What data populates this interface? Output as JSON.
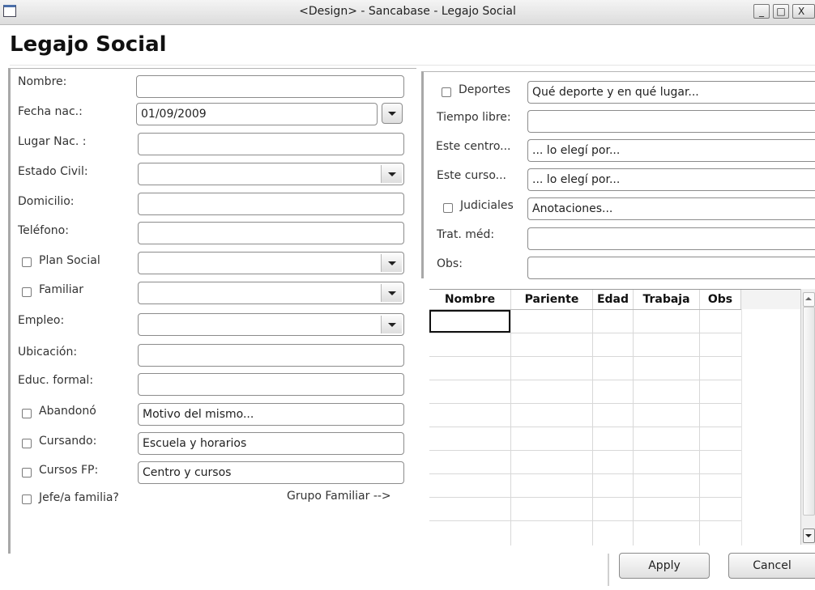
{
  "window": {
    "title": "<Design> - Sancabase - Legajo Social",
    "minimize_label": "_",
    "maximize_label": "□",
    "close_label": "X"
  },
  "heading": "Legajo Social",
  "left": {
    "nombre_label": "Nombre:",
    "nombre_value": "",
    "fecha_label": "Fecha nac.:",
    "fecha_value": "01/09/2009",
    "lugar_label": "Lugar Nac. :",
    "lugar_value": "",
    "estado_label": "Estado Civil:",
    "estado_value": "",
    "domicilio_label": "Domicilio:",
    "domicilio_value": "",
    "telefono_label": "Teléfono:",
    "telefono_value": "",
    "plan_label": "Plan Social",
    "plan_value": "",
    "familiar_label": "Familiar",
    "familiar_value": "",
    "empleo_label": "Empleo:",
    "empleo_value": "",
    "ubicacion_label": "Ubicación:",
    "ubicacion_value": "",
    "educ_label": "Educ. formal:",
    "educ_value": "",
    "abandono_label": "Abandonó",
    "abandono_value": "Motivo del mismo...",
    "cursando_label": "Cursando:",
    "cursando_value": "Escuela y horarios",
    "cursosfp_label": "Cursos FP:",
    "cursosfp_value": "Centro y cursos",
    "jefe_label": "Jefe/a familia?",
    "grupo_link": "Grupo Familiar -->"
  },
  "right": {
    "deportes_label": "Deportes",
    "deportes_value": "Qué deporte y en qué lugar...",
    "tiempo_label": "Tiempo libre:",
    "tiempo_value": "",
    "centro_label": "Este centro...",
    "centro_value": "... lo elegí por...",
    "curso_label": "Este curso...",
    "curso_value": "... lo elegí por...",
    "judiciales_label": "Judiciales",
    "judiciales_value": "Anotaciones...",
    "trat_label": "Trat. méd:",
    "trat_value": "",
    "obs_label": "Obs:",
    "obs_value": ""
  },
  "table": {
    "columns": [
      "Nombre",
      "Pariente",
      "Edad",
      "Trabaja",
      "Obs"
    ],
    "rows": []
  },
  "buttons": {
    "apply": "Apply",
    "cancel": "Cancel"
  }
}
